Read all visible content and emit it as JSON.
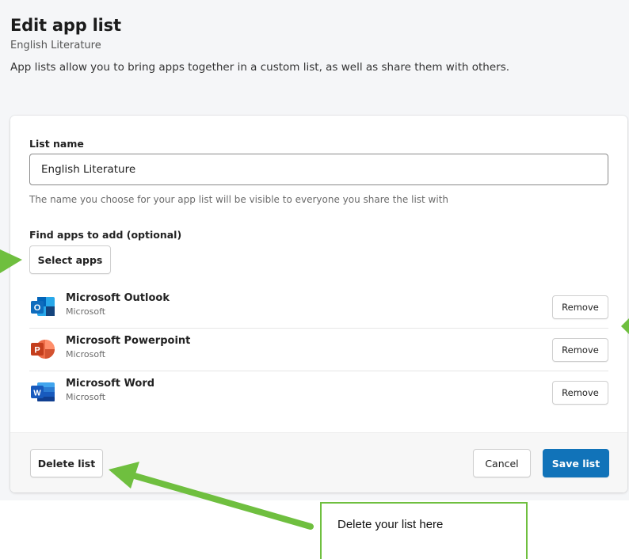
{
  "header": {
    "title": "Edit app list",
    "subtitle": "English Literature",
    "description": "App lists allow you to bring apps together in a custom list, as well as share them with others."
  },
  "form": {
    "list_name_label": "List name",
    "list_name_value": "English Literature",
    "helper_text": "The name you choose for your app list will be visible to everyone you share the list with",
    "find_apps_label": "Find apps to add (optional)",
    "select_apps_label": "Select apps"
  },
  "apps": [
    {
      "name": "Microsoft Outlook",
      "publisher": "Microsoft",
      "icon": "outlook-icon",
      "remove_label": "Remove"
    },
    {
      "name": "Microsoft Powerpoint",
      "publisher": "Microsoft",
      "icon": "powerpoint-icon",
      "remove_label": "Remove"
    },
    {
      "name": "Microsoft Word",
      "publisher": "Microsoft",
      "icon": "word-icon",
      "remove_label": "Remove"
    }
  ],
  "footer": {
    "delete_label": "Delete list",
    "cancel_label": "Cancel",
    "save_label": "Save list"
  },
  "annotation": {
    "callout_text": "Delete your list here"
  },
  "colors": {
    "primary": "#1173b9",
    "annotation_green": "#6fbf3f",
    "outlook": "#0f6cbd",
    "powerpoint": "#c43e1c",
    "word": "#185abd"
  }
}
